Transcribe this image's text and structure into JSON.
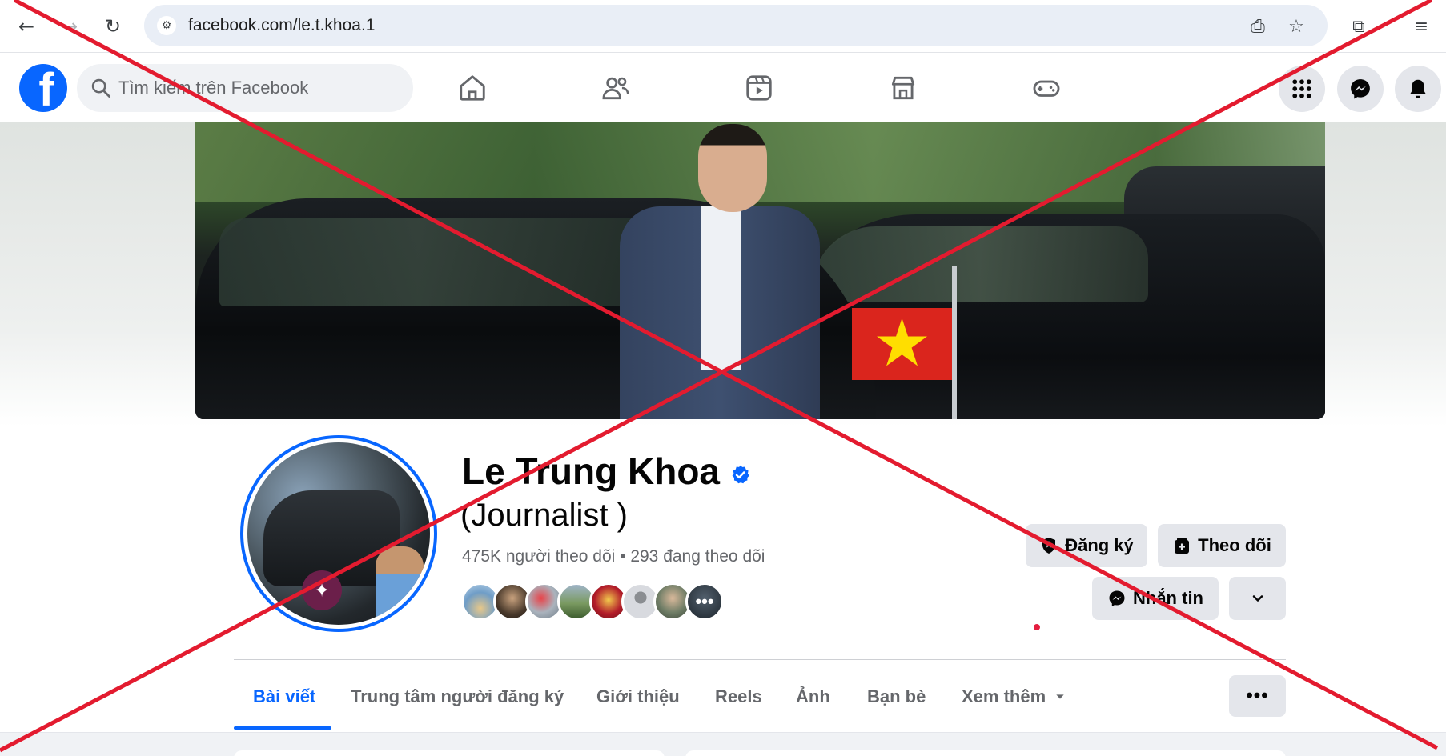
{
  "browser": {
    "back_icon": "arrow-left-icon",
    "forward_icon": "arrow-right-icon",
    "reload_icon": "reload-icon",
    "url": "facebook.com/le.t.khoa.1",
    "site_info_icon": "tune-icon",
    "install_icon": "install-app-icon",
    "bookmark_icon": "star-icon",
    "extensions_icon": "puzzle-icon",
    "media_icon": "media-controls-icon"
  },
  "fb_header": {
    "logo_letter": "f",
    "search_placeholder": "Tìm kiếm trên Facebook",
    "nav_icons": [
      "home-icon",
      "friends-icon",
      "video-icon",
      "marketplace-icon",
      "gaming-icon"
    ],
    "right_icons": [
      "menu-grid-icon",
      "messenger-icon",
      "bell-icon"
    ],
    "brand_color": "#0866ff"
  },
  "profile": {
    "name": "Le Trung Khoa",
    "verified": true,
    "subtitle": "(Journalist )",
    "stats": "475K người theo dõi • 293 đang theo dõi",
    "follower_avatar_count": 8,
    "subscribe_label": "Đăng ký",
    "follow_label": "Theo dõi",
    "message_label": "Nhắn tin"
  },
  "tabs": [
    {
      "label": "Bài viết",
      "active": true
    },
    {
      "label": "Trung tâm người đăng ký",
      "active": false
    },
    {
      "label": "Giới thiệu",
      "active": false
    },
    {
      "label": "Reels",
      "active": false
    },
    {
      "label": "Ảnh",
      "active": false
    },
    {
      "label": "Bạn bè",
      "active": false
    },
    {
      "label": "Xem thêm",
      "active": false,
      "dropdown": true
    }
  ],
  "tabs_more_label": "•••",
  "overlay": {
    "type": "red-x-cross",
    "color": "#e31b2f"
  }
}
